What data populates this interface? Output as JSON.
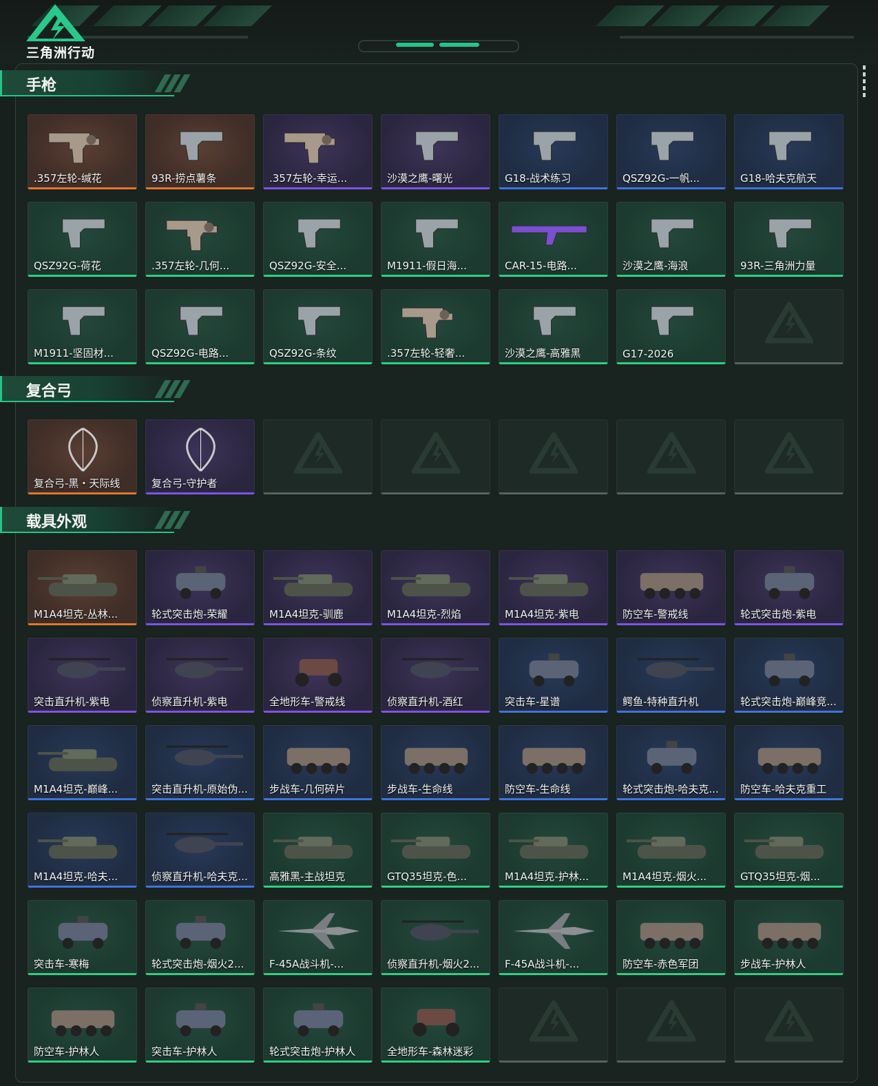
{
  "header": {
    "logo_text": "三角洲行动"
  },
  "colors": {
    "accent": "#26c488",
    "rarity_orange": "#e2762e",
    "rarity_purple": "#7d54e6",
    "rarity_blue": "#3f74e0",
    "rarity_green": "#2fcf83"
  },
  "sections": [
    {
      "title": "手枪",
      "items": [
        {
          "name": ".357左轮-缄花",
          "rarity": "orange",
          "icon": "revolver-icon"
        },
        {
          "name": "93R-捞点薯条",
          "rarity": "orange",
          "icon": "pistol-icon"
        },
        {
          "name": ".357左轮-幸运...",
          "rarity": "purple",
          "icon": "revolver-icon"
        },
        {
          "name": "沙漠之鹰-曙光",
          "rarity": "purple",
          "icon": "pistol-icon"
        },
        {
          "name": "G18-战术练习",
          "rarity": "blue",
          "icon": "pistol-icon"
        },
        {
          "name": "QSZ92G-一帆...",
          "rarity": "blue",
          "icon": "pistol-icon"
        },
        {
          "name": "G18-哈夫克航天",
          "rarity": "blue",
          "icon": "pistol-icon"
        },
        {
          "name": "QSZ92G-荷花",
          "rarity": "green",
          "icon": "pistol-icon"
        },
        {
          "name": ".357左轮-几何...",
          "rarity": "green",
          "icon": "revolver-icon"
        },
        {
          "name": "QSZ92G-安全...",
          "rarity": "green",
          "icon": "pistol-icon"
        },
        {
          "name": "M1911-假日海...",
          "rarity": "green",
          "icon": "pistol-icon"
        },
        {
          "name": "CAR-15-电路...",
          "rarity": "green",
          "icon": "rifle-icon"
        },
        {
          "name": "沙漠之鹰-海浪",
          "rarity": "green",
          "icon": "pistol-icon"
        },
        {
          "name": "93R-三角洲力量",
          "rarity": "green",
          "icon": "pistol-icon"
        },
        {
          "name": "M1911-坚固材...",
          "rarity": "green",
          "icon": "pistol-icon"
        },
        {
          "name": "QSZ92G-电路...",
          "rarity": "green",
          "icon": "pistol-icon"
        },
        {
          "name": "QSZ92G-条纹",
          "rarity": "green",
          "icon": "pistol-icon"
        },
        {
          "name": ".357左轮-轻奢...",
          "rarity": "green",
          "icon": "revolver-icon"
        },
        {
          "name": "沙漠之鹰-高雅黑",
          "rarity": "green",
          "icon": "pistol-icon"
        },
        {
          "name": "G17-2026",
          "rarity": "green",
          "icon": "pistol-icon"
        },
        {
          "name": "",
          "rarity": "empty",
          "icon": "delta-watermark-icon"
        }
      ]
    },
    {
      "title": "复合弓",
      "items": [
        {
          "name": "复合弓-黑・天际线",
          "rarity": "orange",
          "icon": "bow-icon"
        },
        {
          "name": "复合弓-守护者",
          "rarity": "purple",
          "icon": "bow-icon"
        },
        {
          "name": "",
          "rarity": "empty",
          "icon": "delta-watermark-icon"
        },
        {
          "name": "",
          "rarity": "empty",
          "icon": "delta-watermark-icon"
        },
        {
          "name": "",
          "rarity": "empty",
          "icon": "delta-watermark-icon"
        },
        {
          "name": "",
          "rarity": "empty",
          "icon": "delta-watermark-icon"
        },
        {
          "name": "",
          "rarity": "empty",
          "icon": "delta-watermark-icon"
        }
      ]
    },
    {
      "title": "载具外观",
      "items": [
        {
          "name": "M1A4坦克-丛林...",
          "rarity": "orange",
          "icon": "tank-icon"
        },
        {
          "name": "轮式突击炮-荣耀",
          "rarity": "purple",
          "icon": "car-icon"
        },
        {
          "name": "M1A4坦克-驯鹿",
          "rarity": "purple",
          "icon": "tank-icon"
        },
        {
          "name": "M1A4坦克-烈焰",
          "rarity": "purple",
          "icon": "tank-icon"
        },
        {
          "name": "M1A4坦克-紫电",
          "rarity": "purple",
          "icon": "tank-icon"
        },
        {
          "name": "防空车-警戒线",
          "rarity": "purple",
          "icon": "apc-icon"
        },
        {
          "name": "轮式突击炮-紫电",
          "rarity": "purple",
          "icon": "car-icon"
        },
        {
          "name": "突击直升机-紫电",
          "rarity": "purple",
          "icon": "helicopter-icon"
        },
        {
          "name": "侦察直升机-紫电",
          "rarity": "purple",
          "icon": "helicopter-icon"
        },
        {
          "name": "全地形车-警戒线",
          "rarity": "purple",
          "icon": "atv-icon"
        },
        {
          "name": "侦察直升机-酒红",
          "rarity": "purple",
          "icon": "helicopter-icon"
        },
        {
          "name": "突击车-星谱",
          "rarity": "blue",
          "icon": "car-icon"
        },
        {
          "name": "鳄鱼-特种直升机",
          "rarity": "blue",
          "icon": "helicopter-icon"
        },
        {
          "name": "轮式突击炮-巅峰竞...",
          "rarity": "blue",
          "icon": "car-icon"
        },
        {
          "name": "M1A4坦克-巅峰...",
          "rarity": "blue",
          "icon": "tank-icon"
        },
        {
          "name": "突击直升机-原始伪...",
          "rarity": "blue",
          "icon": "helicopter-icon"
        },
        {
          "name": "步战车-几何碎片",
          "rarity": "blue",
          "icon": "apc-icon"
        },
        {
          "name": "步战车-生命线",
          "rarity": "blue",
          "icon": "apc-icon"
        },
        {
          "name": "防空车-生命线",
          "rarity": "blue",
          "icon": "apc-icon"
        },
        {
          "name": "轮式突击炮-哈夫克...",
          "rarity": "blue",
          "icon": "car-icon"
        },
        {
          "name": "防空车-哈夫克重工",
          "rarity": "blue",
          "icon": "apc-icon"
        },
        {
          "name": "M1A4坦克-哈夫...",
          "rarity": "blue",
          "icon": "tank-icon"
        },
        {
          "name": "侦察直升机-哈夫克...",
          "rarity": "blue",
          "icon": "helicopter-icon"
        },
        {
          "name": "高雅黑-主战坦克",
          "rarity": "green",
          "icon": "tank-icon"
        },
        {
          "name": "GTQ35坦克-色...",
          "rarity": "green",
          "icon": "tank-icon"
        },
        {
          "name": "M1A4坦克-护林...",
          "rarity": "green",
          "icon": "tank-icon"
        },
        {
          "name": "M1A4坦克-烟火...",
          "rarity": "green",
          "icon": "tank-icon"
        },
        {
          "name": "GTQ35坦克-烟...",
          "rarity": "green",
          "icon": "tank-icon"
        },
        {
          "name": "突击车-寒梅",
          "rarity": "green",
          "icon": "car-icon"
        },
        {
          "name": "轮式突击炮-烟火2...",
          "rarity": "green",
          "icon": "car-icon"
        },
        {
          "name": "F-45A战斗机-...",
          "rarity": "green",
          "icon": "jet-icon"
        },
        {
          "name": "侦察直升机-烟火2...",
          "rarity": "green",
          "icon": "helicopter-icon"
        },
        {
          "name": "F-45A战斗机-...",
          "rarity": "green",
          "icon": "jet-icon"
        },
        {
          "name": "防空车-赤色军团",
          "rarity": "green",
          "icon": "apc-icon"
        },
        {
          "name": "步战车-护林人",
          "rarity": "green",
          "icon": "apc-icon"
        },
        {
          "name": "防空车-护林人",
          "rarity": "green",
          "icon": "apc-icon"
        },
        {
          "name": "突击车-护林人",
          "rarity": "green",
          "icon": "car-icon"
        },
        {
          "name": "轮式突击炮-护林人",
          "rarity": "green",
          "icon": "car-icon"
        },
        {
          "name": "全地形车-森林迷彩",
          "rarity": "green",
          "icon": "atv-icon"
        },
        {
          "name": "",
          "rarity": "empty",
          "icon": "delta-watermark-icon"
        },
        {
          "name": "",
          "rarity": "empty",
          "icon": "delta-watermark-icon"
        },
        {
          "name": "",
          "rarity": "empty",
          "icon": "delta-watermark-icon"
        }
      ]
    }
  ]
}
